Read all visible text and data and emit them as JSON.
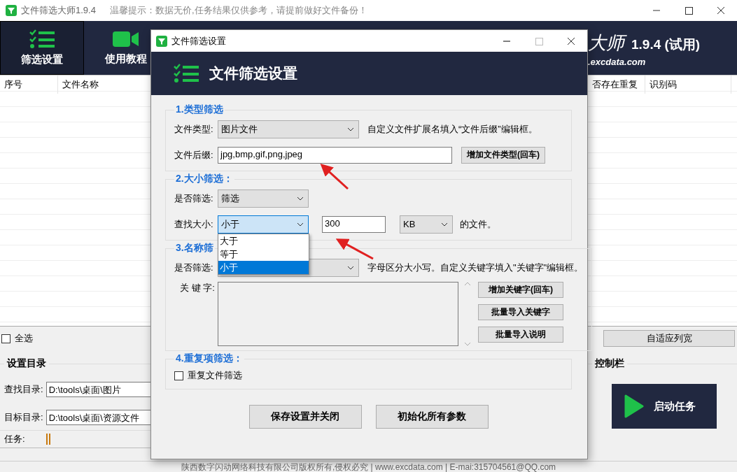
{
  "main_window": {
    "title": "文件筛选大师1.9.4",
    "notice": "温馨提示：数据无价,任务结果仅供参考，请提前做好文件备份！",
    "nav_tabs": [
      {
        "label": "筛选设置",
        "selected": true
      },
      {
        "label": "使用教程",
        "selected": false
      }
    ],
    "brand": {
      "name": "大师",
      "version": "1.9.4 (试用)",
      "site": ".excdata.com"
    },
    "table": {
      "columns": [
        "序号",
        "文件名称",
        "否存在重复",
        "识别码"
      ]
    },
    "select_all": {
      "label": "全选",
      "checked": false
    },
    "fit_columns_button": "自适应列宽",
    "directory_group": {
      "title": "设置目录",
      "fields": [
        {
          "label": "查找目录:",
          "value": "D:\\tools\\桌面\\图片"
        },
        {
          "label": "目标目录:",
          "value": "D:\\tools\\桌面\\资源文件"
        }
      ]
    },
    "control_group": {
      "title": "控制栏",
      "start_button": "启动任务"
    },
    "task": {
      "label": "任务:"
    },
    "footer": "陕西数字闪动网络科技有限公司版权所有,侵权必究 | www.excdata.com | E-mai:315704561@QQ.com"
  },
  "dialog": {
    "title": "文件筛选设置",
    "heading": "文件筛选设置",
    "type_group": {
      "title": "1.类型筛选",
      "file_type": {
        "label": "文件类型:",
        "value": "图片文件"
      },
      "hint": "自定义文件扩展名填入“文件后缀”编辑框。",
      "suffix": {
        "label": "文件后缀:",
        "value": "jpg,bmp,gif,png,jpeg"
      },
      "add_button": "增加文件类型(回车)"
    },
    "size_group": {
      "title": "2.大小筛选：",
      "enable": {
        "label": "是否筛选:",
        "value": "筛选"
      },
      "size": {
        "label": "查找大小:",
        "value": "小于",
        "expanded": true,
        "options": [
          {
            "label": "大于",
            "selected": false
          },
          {
            "label": "等于",
            "selected": false
          },
          {
            "label": "小于",
            "selected": true
          }
        ]
      },
      "amount": "300",
      "unit": "KB",
      "tail": "的文件。"
    },
    "name_group": {
      "title": "3.名称筛",
      "enable": {
        "label": "是否筛选:"
      },
      "hint": "字母区分大小写。自定义关键字填入\"关键字\"编辑框。",
      "keywords": {
        "label": "关 键 字:"
      },
      "buttons": [
        "增加关键字(回车)",
        "批量导入关键字",
        "批量导入说明"
      ]
    },
    "duplicate_group": {
      "title": "4.重复项筛选：",
      "checkbox": {
        "label": "重复文件筛选",
        "checked": false
      }
    },
    "buttons": [
      "保存设置并关闭",
      "初始化所有参数"
    ]
  }
}
